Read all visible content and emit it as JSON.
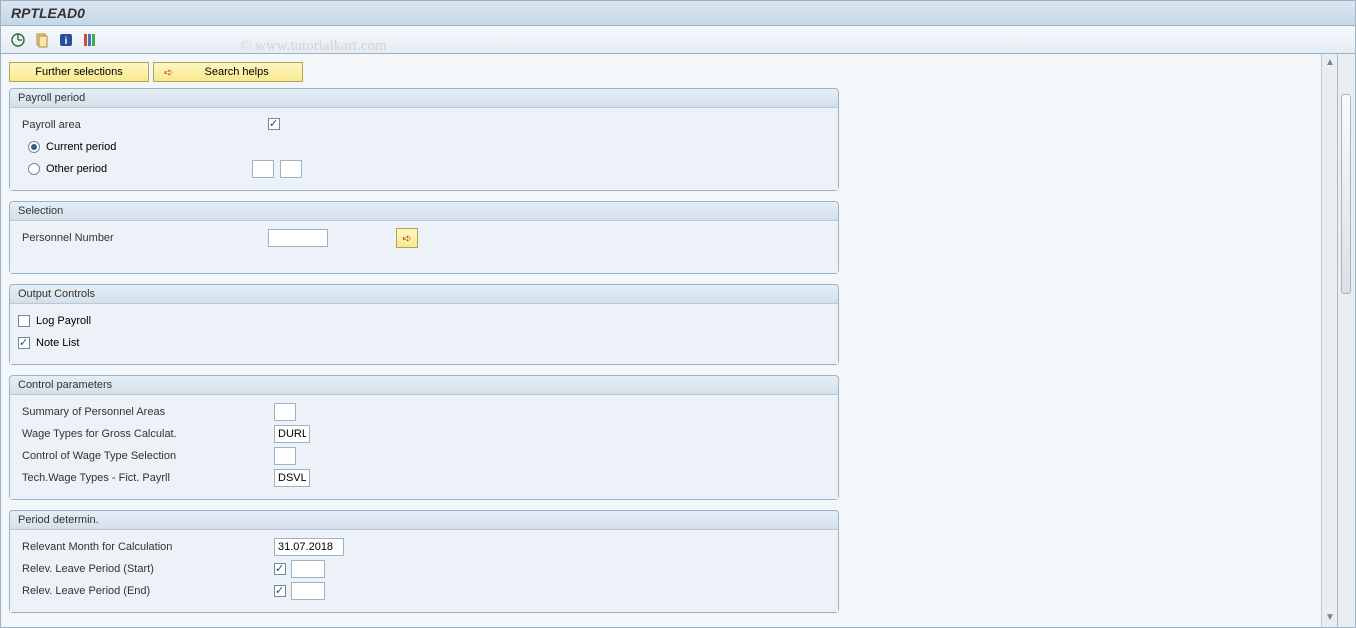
{
  "title": "RPTLEAD0",
  "watermark": "© www.tutorialkart.com",
  "buttons": {
    "further_selections": "Further selections",
    "search_helps": "Search helps"
  },
  "groups": {
    "payroll_period": {
      "title": "Payroll period",
      "payroll_area_label": "Payroll area",
      "current_period_label": "Current period",
      "other_period_label": "Other period"
    },
    "selection": {
      "title": "Selection",
      "personnel_number_label": "Personnel Number"
    },
    "output_controls": {
      "title": "Output Controls",
      "log_payroll_label": "Log Payroll",
      "note_list_label": "Note List"
    },
    "control_parameters": {
      "title": "Control parameters",
      "summary_label": "Summary of Personnel Areas",
      "wage_types_gross_label": "Wage Types for Gross Calculat.",
      "wage_types_gross_value": "DURL",
      "control_wage_sel_label": "Control of Wage Type Selection",
      "tech_wage_label": "Tech.Wage Types - Fict. Payrll",
      "tech_wage_value": "DSVL"
    },
    "period_determin": {
      "title": "Period determin.",
      "relevant_month_label": "Relevant Month for Calculation",
      "relevant_month_value": "31.07.2018",
      "relev_start_label": "Relev. Leave Period (Start)",
      "relev_end_label": "Relev. Leave Period (End)"
    }
  }
}
